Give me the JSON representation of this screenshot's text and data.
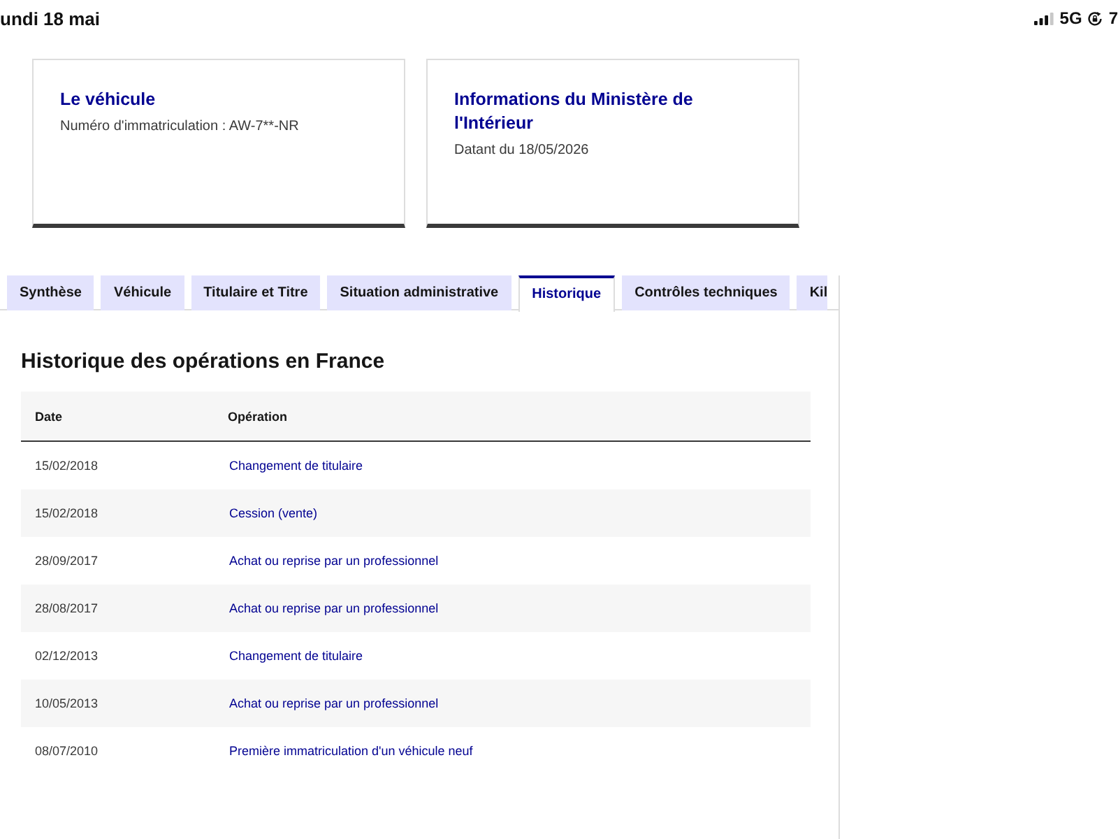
{
  "status_bar": {
    "date": "undi 18 mai",
    "network": "5G",
    "battery": "7"
  },
  "cards": [
    {
      "title": "Le véhicule",
      "subtitle": "Numéro d'immatriculation : AW-7**-NR"
    },
    {
      "title": "Informations du Ministère de l'Intérieur",
      "subtitle": "Datant du 18/05/2026"
    }
  ],
  "tabs": [
    {
      "label": "Synthèse",
      "selected": false
    },
    {
      "label": "Véhicule",
      "selected": false
    },
    {
      "label": "Titulaire et Titre",
      "selected": false
    },
    {
      "label": "Situation administrative",
      "selected": false
    },
    {
      "label": "Historique",
      "selected": true
    },
    {
      "label": "Contrôles techniques",
      "selected": false
    },
    {
      "label": "Kil",
      "selected": false
    }
  ],
  "section_title": "Historique des opérations en France",
  "table": {
    "columns": [
      "Date",
      "Opération"
    ],
    "rows": [
      [
        "15/02/2018",
        "Changement de titulaire"
      ],
      [
        "15/02/2018",
        "Cession (vente)"
      ],
      [
        "28/09/2017",
        "Achat ou reprise par un professionnel"
      ],
      [
        "28/08/2017",
        "Achat ou reprise par un professionnel"
      ],
      [
        "02/12/2013",
        "Changement de titulaire"
      ],
      [
        "10/05/2013",
        "Achat ou reprise par un professionnel"
      ],
      [
        "08/07/2010",
        "Première immatriculation d'un véhicule neuf"
      ]
    ]
  }
}
